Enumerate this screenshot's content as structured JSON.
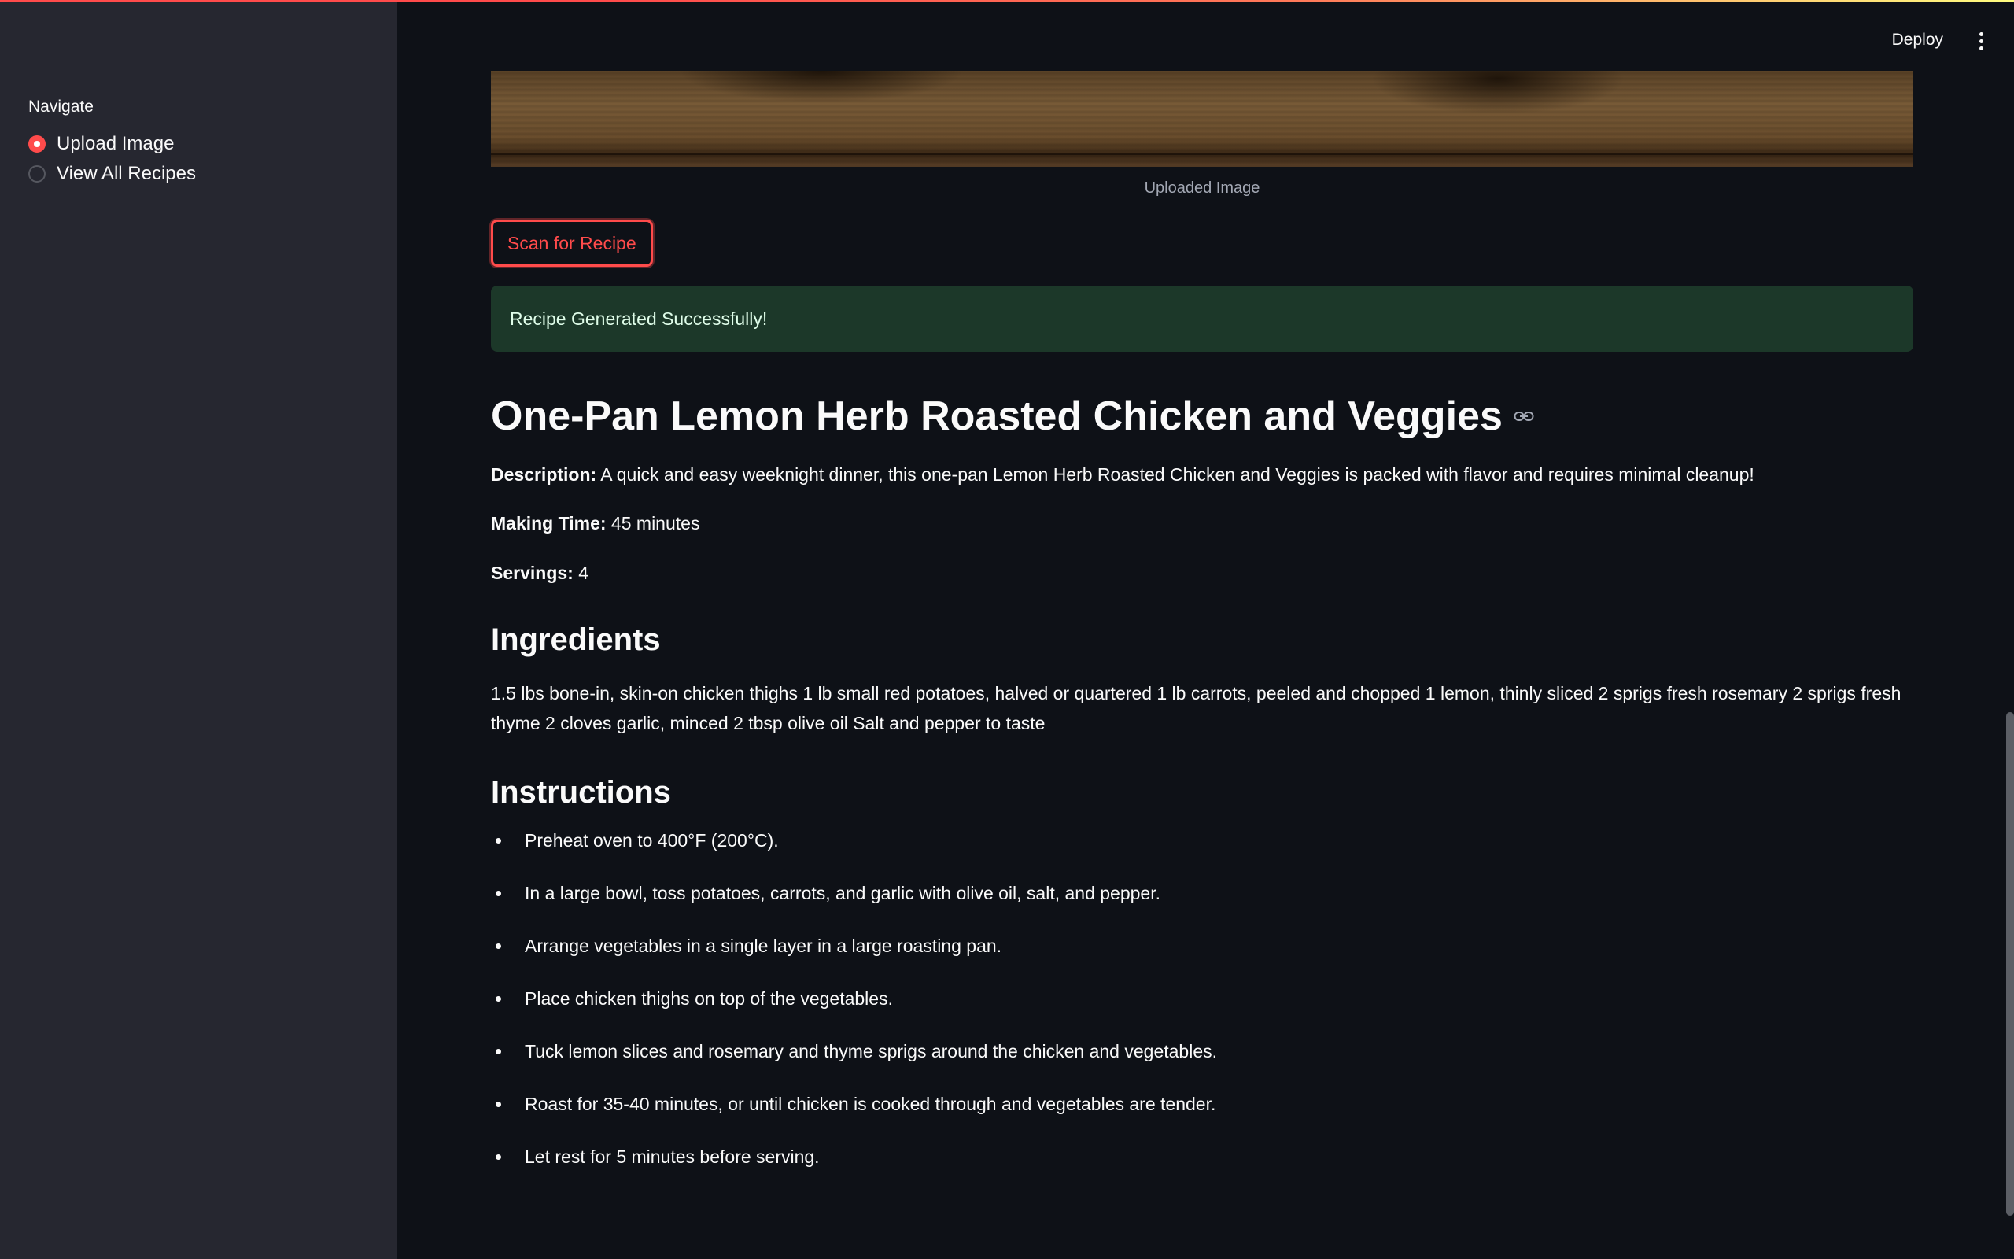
{
  "sidebar": {
    "nav_title": "Navigate",
    "options": [
      {
        "label": "Upload Image",
        "selected": true
      },
      {
        "label": "View All Recipes",
        "selected": false
      }
    ]
  },
  "header": {
    "deploy_label": "Deploy",
    "menu_icon": "kebab-menu-icon"
  },
  "main": {
    "image_caption": "Uploaded Image",
    "scan_button_label": "Scan for Recipe",
    "success_message": "Recipe Generated Successfully!",
    "recipe": {
      "title": "One-Pan Lemon Herb Roasted Chicken and Veggies",
      "description_label": "Description:",
      "description": " A quick and easy weeknight dinner, this one-pan Lemon Herb Roasted Chicken and Veggies is packed with flavor and requires minimal cleanup!",
      "making_time_label": "Making Time:",
      "making_time": " 45 minutes",
      "servings_label": "Servings:",
      "servings": " 4",
      "ingredients_heading": "Ingredients",
      "ingredients_text": "1.5 lbs bone-in, skin-on chicken thighs 1 lb small red potatoes, halved or quartered 1 lb carrots, peeled and chopped 1 lemon, thinly sliced 2 sprigs fresh rosemary 2 sprigs fresh thyme 2 cloves garlic, minced 2 tbsp olive oil Salt and pepper to taste",
      "instructions_heading": "Instructions",
      "instructions": [
        "Preheat oven to 400°F (200°C).",
        "In a large bowl, toss potatoes, carrots, and garlic with olive oil, salt, and pepper.",
        "Arrange vegetables in a single layer in a large roasting pan.",
        "Place chicken thighs on top of the vegetables.",
        "Tuck lemon slices and rosemary and thyme sprigs around the chicken and vegetables.",
        "Roast for 35-40 minutes, or until chicken is cooked through and vegetables are tender.",
        "Let rest for 5 minutes before serving."
      ]
    }
  },
  "colors": {
    "accent": "#ff4b4b",
    "sidebar_bg": "#262730",
    "main_bg": "#0e1117",
    "success_bg": "#1c3829"
  }
}
